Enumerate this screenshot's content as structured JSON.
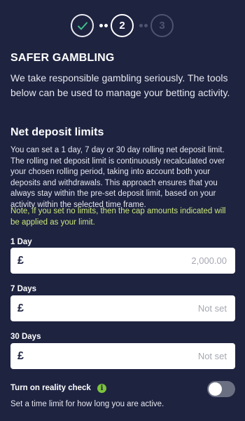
{
  "stepper": {
    "steps": [
      {
        "label": "",
        "state": "completed",
        "icon": "check-icon"
      },
      {
        "label": "2",
        "state": "active"
      },
      {
        "label": "3",
        "state": "upcoming"
      }
    ]
  },
  "safer_gambling": {
    "title": "SAFER GAMBLING",
    "intro": "We take responsible gambling seriously. The tools below can be used to manage your betting activity."
  },
  "net_deposit": {
    "title": "Net deposit limits",
    "description": "You can set a 1 day, 7 day or 30 day rolling net deposit limit. The rolling net deposit limit is continuously recalculated over your chosen rolling period, taking into account both your deposits and withdrawals. This approach ensures that you always stay within the pre-set deposit limit, based on your activity within the selected time frame.",
    "note": "Note, if you set no limits, then the cap amounts indicated will be applied as your limit.",
    "fields": [
      {
        "label": "1 Day",
        "currency": "£",
        "value": "2,000.00"
      },
      {
        "label": "7 Days",
        "currency": "£",
        "value": "Not set"
      },
      {
        "label": "30 Days",
        "currency": "£",
        "value": "Not set"
      }
    ]
  },
  "reality_check": {
    "label": "Turn on reality check",
    "info_icon": "i",
    "enabled": false,
    "description": "Set a time limit for how long you are active."
  },
  "colors": {
    "background": "#1e2340",
    "check": "#3fbf8a",
    "note": "#cde87a",
    "info": "#7cc43d",
    "toggle_off": "#6b6f82"
  }
}
